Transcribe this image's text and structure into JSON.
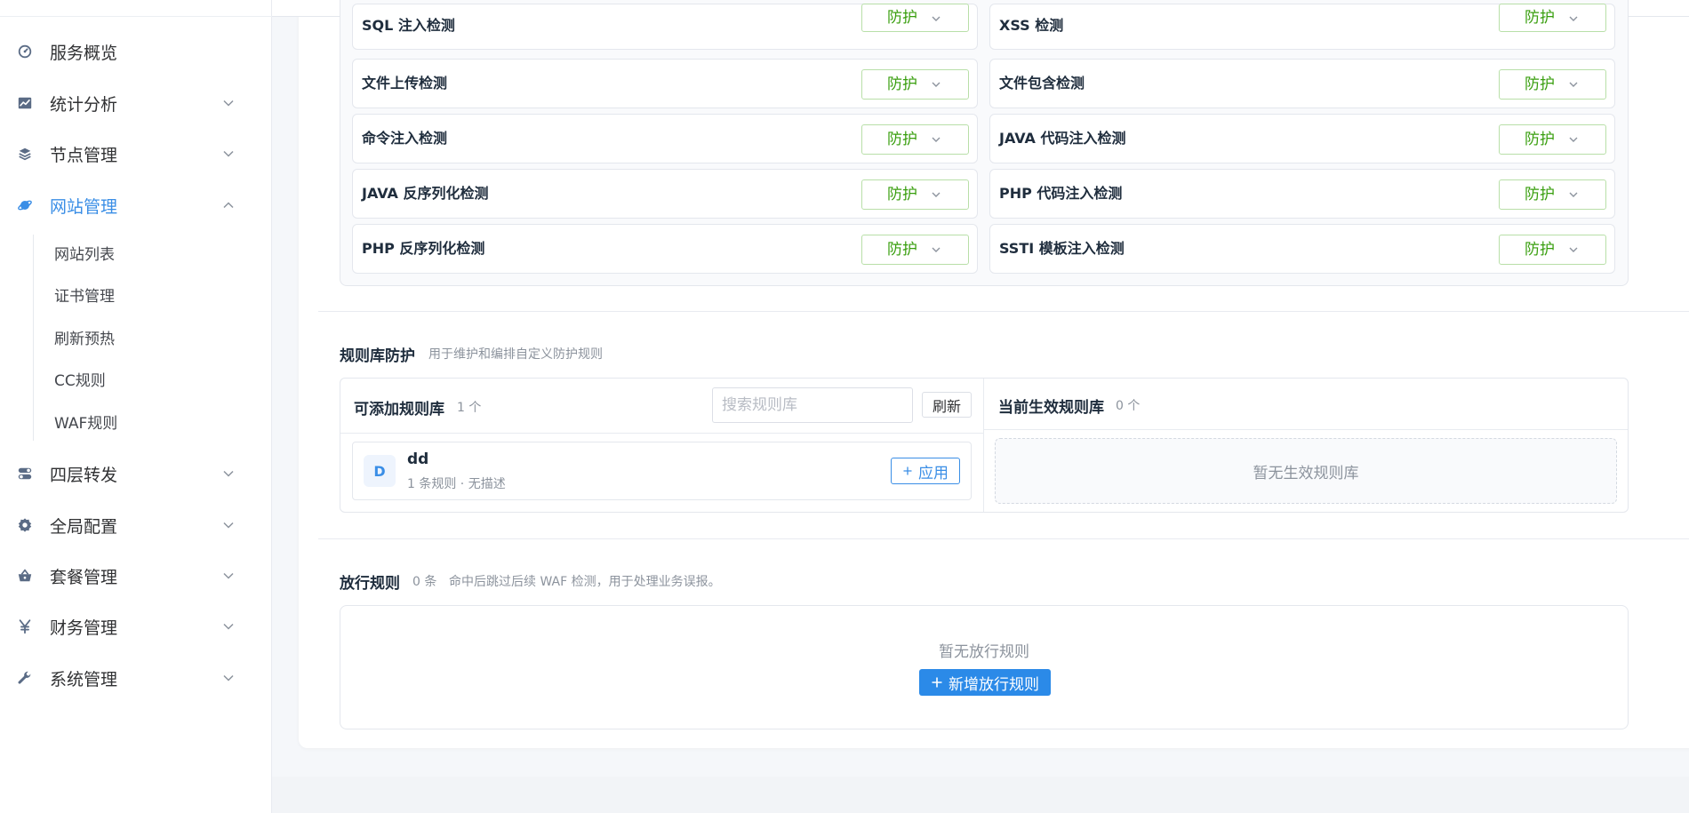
{
  "sidebar": {
    "items": [
      {
        "label": "服务概览",
        "icon": "dashboard-icon",
        "has_chevron": false
      },
      {
        "label": "统计分析",
        "icon": "chart-icon",
        "has_chevron": true
      },
      {
        "label": "节点管理",
        "icon": "layers-icon",
        "has_chevron": true
      },
      {
        "label": "网站管理",
        "icon": "planet-icon",
        "has_chevron": true,
        "active": true
      },
      {
        "label": "四层转发",
        "icon": "toggle-icon",
        "has_chevron": true
      },
      {
        "label": "全局配置",
        "icon": "gear-icon",
        "has_chevron": true
      },
      {
        "label": "套餐管理",
        "icon": "basket-icon",
        "has_chevron": true
      },
      {
        "label": "财务管理",
        "icon": "yen-icon",
        "has_chevron": true
      },
      {
        "label": "系统管理",
        "icon": "wrench-icon",
        "has_chevron": true
      }
    ],
    "sub_items": [
      "网站列表",
      "证书管理",
      "刷新预热",
      "CC规则",
      "WAF规则"
    ]
  },
  "detections": [
    {
      "name": "SQL 注入检测",
      "mode": "防护"
    },
    {
      "name": "XSS 检测",
      "mode": "防护"
    },
    {
      "name": "文件上传检测",
      "mode": "防护"
    },
    {
      "name": "文件包含检测",
      "mode": "防护"
    },
    {
      "name": "命令注入检测",
      "mode": "防护"
    },
    {
      "name": "JAVA 代码注入检测",
      "mode": "防护"
    },
    {
      "name": "JAVA 反序列化检测",
      "mode": "防护"
    },
    {
      "name": "PHP 代码注入检测",
      "mode": "防护"
    },
    {
      "name": "PHP 反序列化检测",
      "mode": "防护"
    },
    {
      "name": "SSTI 模板注入检测",
      "mode": "防护"
    }
  ],
  "rule_library": {
    "title": "规则库防护",
    "desc": "用于维护和编排自定义防护规则",
    "available": {
      "title": "可添加规则库",
      "count": "1 个",
      "search_placeholder": "搜索规则库",
      "refresh_label": "刷新",
      "items": [
        {
          "avatar": "D",
          "name": "dd",
          "meta": "1 条规则 · 无描述",
          "apply_label": "应用"
        }
      ]
    },
    "active": {
      "title": "当前生效规则库",
      "count": "0 个",
      "empty_text": "暂无生效规则库"
    }
  },
  "pass_rules": {
    "title": "放行规则",
    "count": "0 条",
    "desc": "命中后跳过后续 WAF 检测，用于处理业务误报。",
    "empty_text": "暂无放行规则",
    "add_label": "新增放行规则"
  },
  "colors": {
    "accent": "#3a8ee6",
    "protect_green": "#389e0d",
    "primary_button": "#2b8ae8"
  }
}
